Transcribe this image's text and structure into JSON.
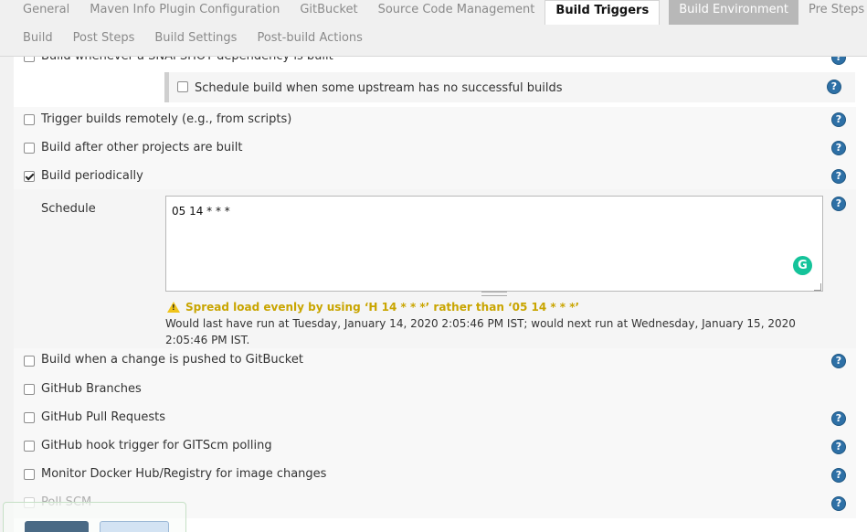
{
  "tabs_row1": [
    "General",
    "Maven Info Plugin Configuration",
    "GitBucket",
    "Source Code Management",
    "Build Triggers",
    "Build Environment",
    "Pre Steps"
  ],
  "tabs_row2": [
    "Build",
    "Post Steps",
    "Build Settings",
    "Post-build Actions"
  ],
  "active_tab": "Build Triggers",
  "triggers": {
    "snapshot_label": "Build whenever a SNAPSHOT dependency is built",
    "upstream_label": "Schedule build when some upstream has no successful builds",
    "remote_label": "Trigger builds remotely (e.g., from scripts)",
    "after_label": "Build after other projects are built",
    "periodic_label": "Build periodically",
    "gitbucket_label": "Build when a change is pushed to GitBucket",
    "gh_branches_label": "GitHub Branches",
    "gh_pr_label": "GitHub Pull Requests",
    "gh_hook_label": "GitHub hook trigger for GITScm polling",
    "docker_label": "Monitor Docker Hub/Registry for image changes",
    "poll_label": "Poll SCM"
  },
  "schedule": {
    "label": "Schedule",
    "value": "05 14 * * *",
    "warning": "Spread load evenly by using ‘H 14 * * *’ rather than ‘05 14 * * *’",
    "info": "Would last have run at Tuesday, January 14, 2020 2:05:46 PM IST; would next run at Wednesday, January 15, 2020 2:05:46 PM IST."
  },
  "help_glyph": "?",
  "grammarly_glyph": "G",
  "icons": {
    "help": "help-icon",
    "warning": "warning-icon",
    "grammarly": "grammarly-icon"
  },
  "colors": {
    "help_blue": "#2e70a6",
    "warning_yellow": "#c9a500",
    "grammarly_green": "#15c39a"
  }
}
